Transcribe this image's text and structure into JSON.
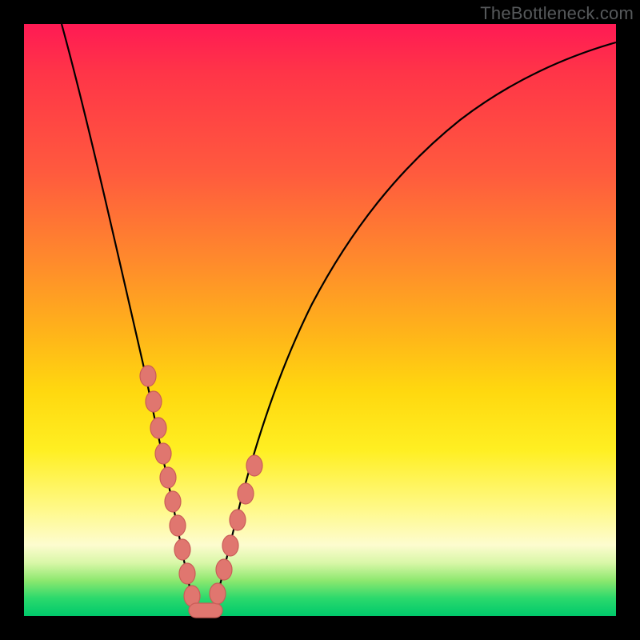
{
  "watermark": "TheBottleneck.com",
  "chart_data": {
    "type": "line",
    "title": "",
    "xlabel": "",
    "ylabel": "",
    "xlim": [
      0,
      100
    ],
    "ylim": [
      0,
      100
    ],
    "series": [
      {
        "name": "bottleneck-curve",
        "x": [
          0,
          4,
          8,
          12,
          15,
          18,
          20,
          22,
          24,
          26,
          27,
          28,
          29,
          30,
          32,
          34,
          36,
          40,
          45,
          50,
          55,
          60,
          67,
          75,
          83,
          91,
          100
        ],
        "values": [
          100,
          90,
          80,
          70,
          61,
          52,
          45,
          37,
          28,
          18,
          10,
          4,
          1,
          0,
          1,
          6,
          13,
          24,
          36,
          46,
          54,
          61,
          69,
          76,
          82,
          87,
          91
        ]
      }
    ],
    "markers": {
      "name": "highlight-beads",
      "x": [
        20.5,
        21.8,
        22.8,
        23.5,
        24.2,
        25.0,
        25.8,
        26.6,
        27.4,
        28.3,
        32.0,
        33.2,
        34.4,
        35.8,
        37.2,
        38.6
      ],
      "values": [
        43,
        38,
        34,
        30,
        27,
        23,
        19,
        14,
        9,
        3,
        1,
        5,
        9,
        13,
        16,
        20
      ]
    },
    "annotations": []
  }
}
